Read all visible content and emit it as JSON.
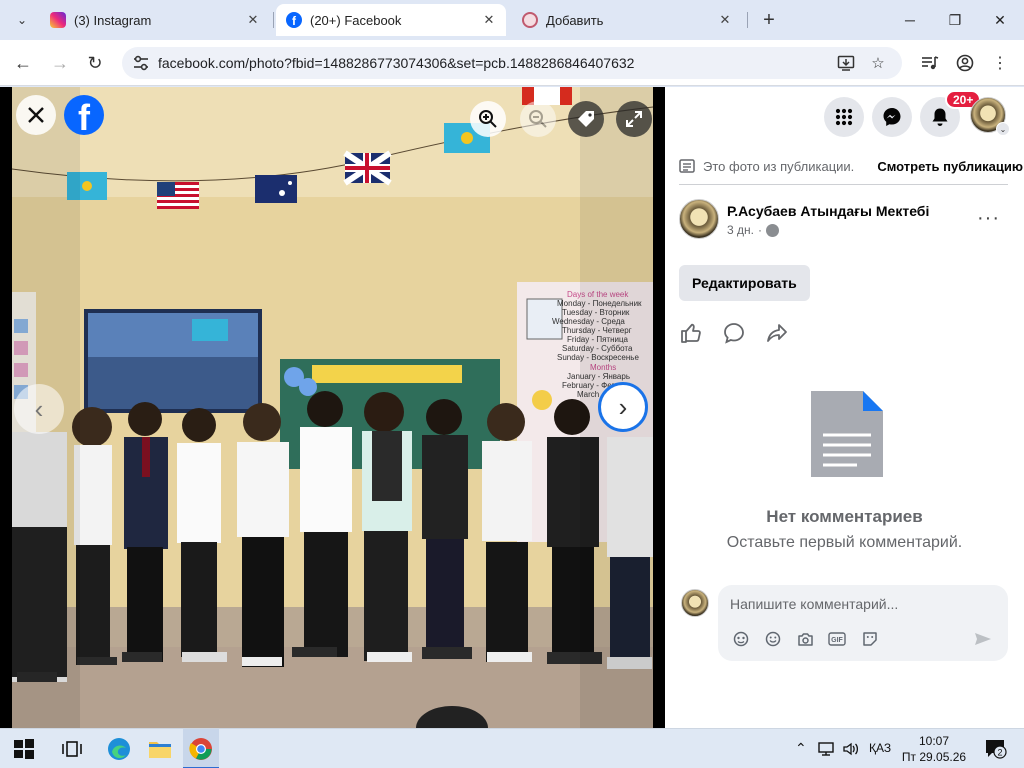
{
  "browser": {
    "tabs": [
      {
        "title": "(3) Instagram",
        "active": false
      },
      {
        "title": "(20+) Facebook",
        "active": true
      },
      {
        "title": "Добавить",
        "active": false
      }
    ],
    "url": "facebook.com/photo?fbid=1488286773074306&set=pcb.1488286846407632"
  },
  "colors": {
    "fb_blue": "#0866ff",
    "badge_red": "#e41e3f",
    "panel_bg": "#ffffff"
  },
  "viewer": {
    "icons": [
      "close-icon",
      "facebook-logo",
      "zoom-in-icon",
      "zoom-out-icon",
      "tag-icon",
      "fullscreen-icon",
      "previous-arrow-icon",
      "next-arrow-icon"
    ],
    "logo_letter": "f"
  },
  "header": {
    "notifications_badge": "20+"
  },
  "post": {
    "from_post_text": "Это фото из публикации.",
    "see_post_label": "Смотреть публикацию",
    "page_name": "Р.Асубаев Атындағы Мектебі",
    "time": "3 дн.",
    "time_separator": "·",
    "edit_label": "Редактировать",
    "more_label": "···"
  },
  "comments": {
    "empty_title": "Нет комментариев",
    "empty_subtitle": "Оставьте первый комментарий.",
    "input_placeholder": "Напишите комментарий...",
    "gif_label": "GIF"
  },
  "taskbar": {
    "language": "ҚАЗ",
    "time": "10:07",
    "date": "Пт 29.05.26",
    "notifications": "2"
  }
}
